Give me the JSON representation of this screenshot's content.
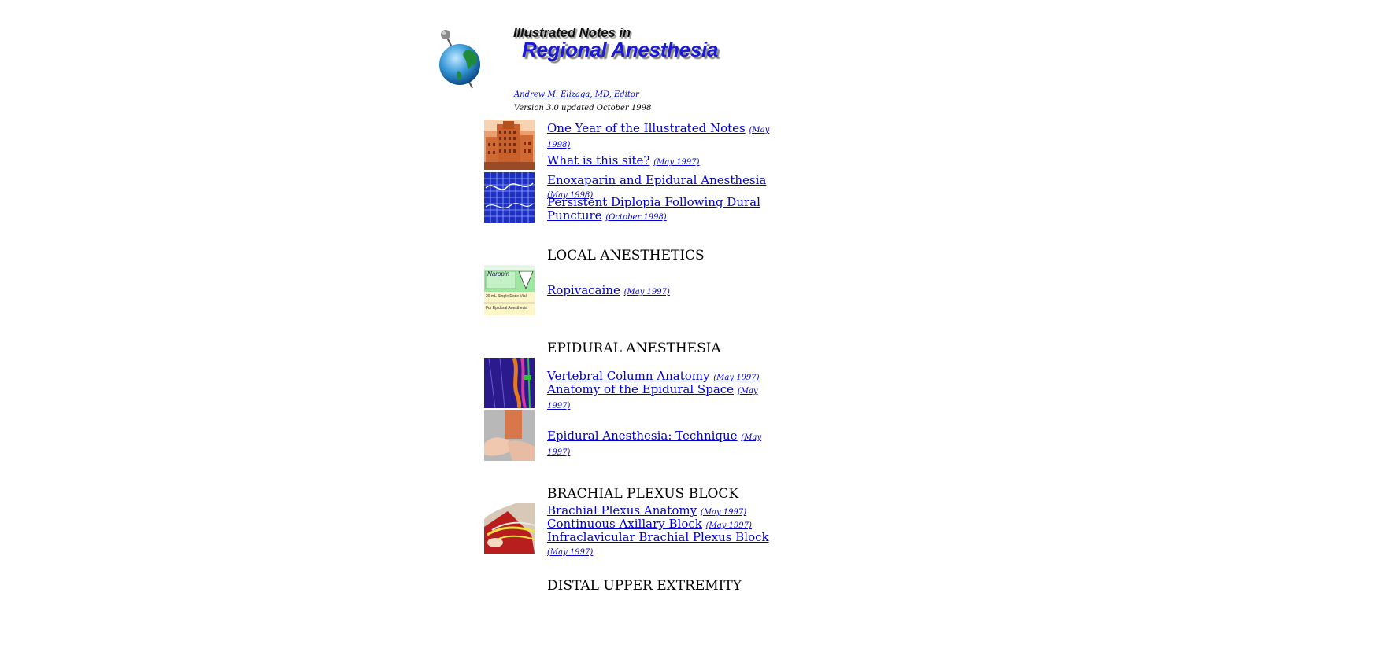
{
  "header": {
    "title_line1": "Illustrated Notes in",
    "title_line2": "Regional Anesthesia",
    "editor_link": "Andrew M. Elizaga, MD, Editor",
    "version": "Version 3.0 updated October 1998"
  },
  "intro": {
    "items": [
      {
        "title": "One Year of the Illustrated Notes",
        "date": "(May 1998)"
      },
      {
        "title": "What is this site?",
        "date": "(May 1997)"
      },
      {
        "title": "Enoxaparin and Epidural Anesthesia",
        "date": "(May 1998)"
      },
      {
        "title": "Persistent Diplopia Following Dural Puncture",
        "date": "(October 1998)"
      }
    ]
  },
  "sections": {
    "local": {
      "heading": "LOCAL ANESTHETICS",
      "items": [
        {
          "title": "Ropivacaine",
          "date": "(May 1997)"
        }
      ]
    },
    "epidural": {
      "heading": "EPIDURAL ANESTHESIA",
      "items": [
        {
          "title": "Vertebral Column Anatomy",
          "date": "(May 1997)"
        },
        {
          "title": "Anatomy of the Epidural Space",
          "date": "(May 1997)"
        },
        {
          "title": "Epidural Anesthesia: Technique",
          "date": "(May 1997)"
        }
      ]
    },
    "brachial": {
      "heading": "BRACHIAL PLEXUS BLOCK",
      "items": [
        {
          "title": "Brachial Plexus Anatomy",
          "date": "(May 1997)"
        },
        {
          "title": "Continuous Axillary Block",
          "date": "(May 1997)"
        },
        {
          "title": "Infraclavicular Brachial Plexus Block",
          "date": "(May 1997)"
        }
      ]
    },
    "distal": {
      "heading": "DISTAL UPPER EXTREMITY"
    }
  },
  "thumbnails": {
    "drug_label_text": "Naropin",
    "drug_label_volume": "20 mL Single Dose Vial",
    "drug_label_use": "For Epidural Anesthesia"
  },
  "colors": {
    "link": "#0000cc",
    "title_blue": "#1a1ad8"
  }
}
